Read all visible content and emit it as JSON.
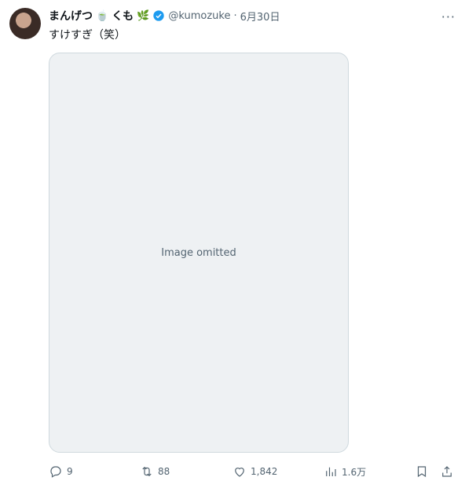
{
  "tweet": {
    "display_name": "まんげつ",
    "display_name_suffix": "くも",
    "handle": "@kumozuke",
    "date": "6月30日",
    "text": "すけすぎ（笑）"
  },
  "media": {
    "note": "Image omitted"
  },
  "actions": {
    "replies": "9",
    "retweets": "88",
    "likes": "1,842",
    "views": "1.6万"
  },
  "icons": [
    "verified-badge-icon",
    "more-icon",
    "reply-icon",
    "retweet-icon",
    "like-icon",
    "views-icon",
    "bookmark-icon",
    "share-icon"
  ],
  "colors": {
    "verified": "#1d9bf0",
    "secondary_text": "#536471"
  }
}
